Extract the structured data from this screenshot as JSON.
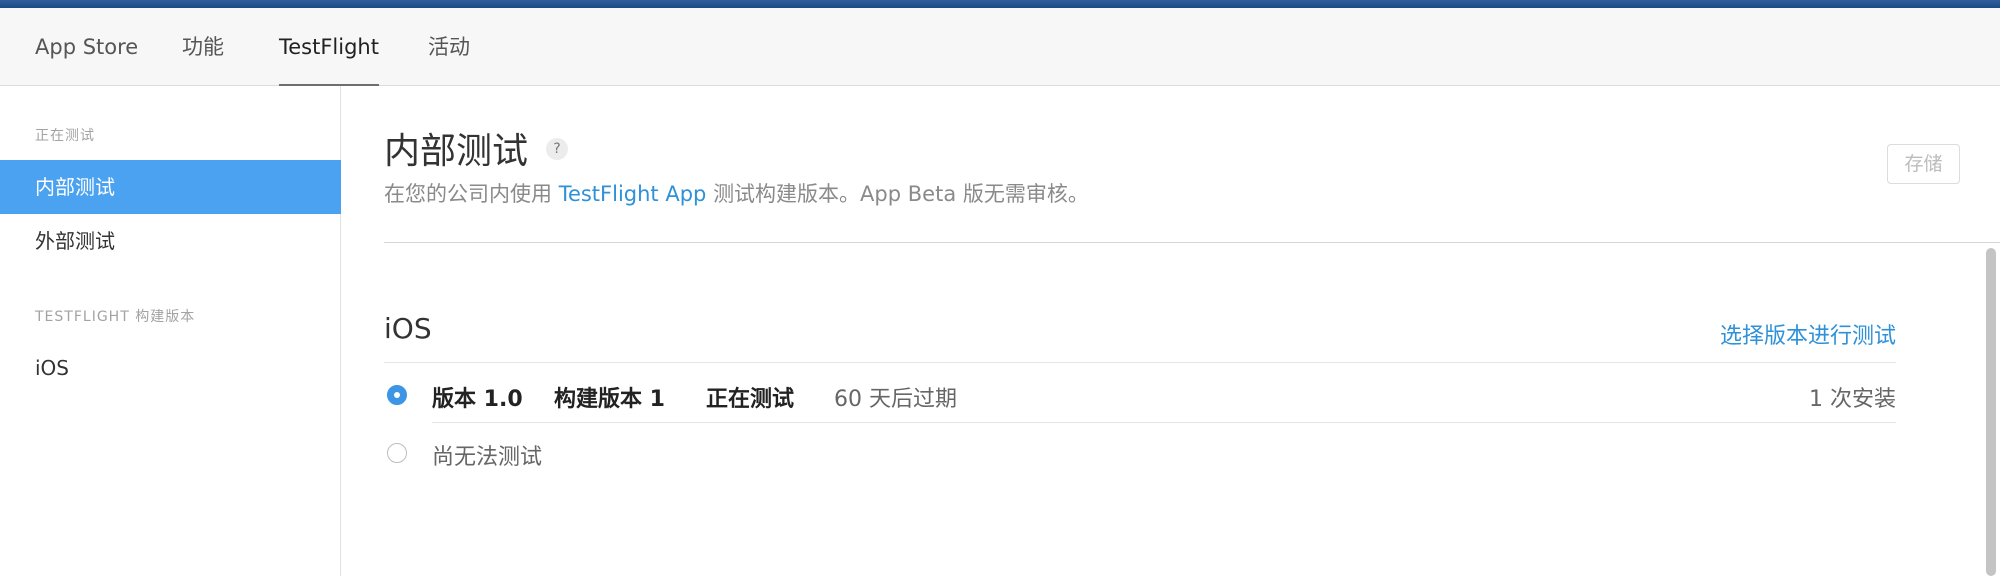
{
  "nav": {
    "tabs": [
      {
        "label": "App Store"
      },
      {
        "label": "功能"
      },
      {
        "label": "TestFlight"
      },
      {
        "label": "活动"
      }
    ]
  },
  "sidebar": {
    "section1_heading": "正在测试",
    "items": [
      {
        "label": "内部测试"
      },
      {
        "label": "外部测试"
      }
    ],
    "section2_heading": "TESTFLIGHT 构建版本",
    "build_items": [
      {
        "label": "iOS"
      }
    ]
  },
  "main": {
    "title": "内部测试",
    "help_glyph": "?",
    "subtitle_prefix": "在您的公司内使用",
    "subtitle_link": "TestFlight App",
    "subtitle_suffix": "测试构建版本。App Beta 版无需审核。",
    "save_label": "存储",
    "section_title": "iOS",
    "select_link": "选择版本进行测试",
    "builds": [
      {
        "version": "版本 1.0",
        "build": "构建版本 1",
        "status": "正在测试",
        "expiry": "60 天后过期",
        "installs": "1 次安装",
        "selected": true
      },
      {
        "label": "尚无法测试",
        "selected": false
      }
    ]
  },
  "colors": {
    "accent": "#4aa2f0",
    "link": "#2f91d8",
    "topbar": "#1d4a86"
  }
}
